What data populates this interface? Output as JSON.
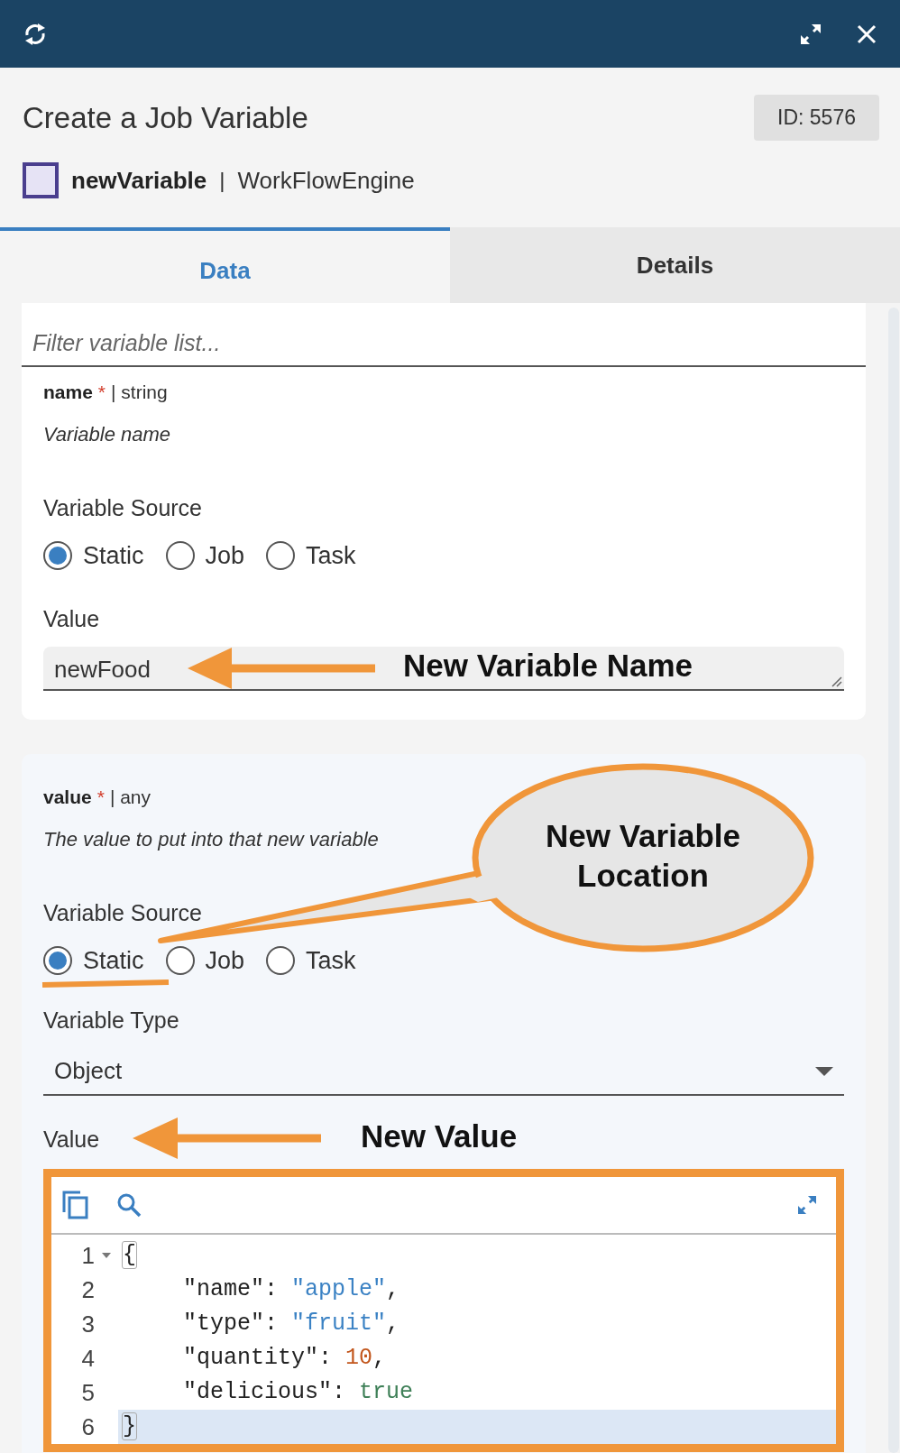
{
  "header": {
    "title": "Create a Job Variable",
    "id_badge": "ID: 5576",
    "name": "newVariable",
    "separator": "|",
    "engine": "WorkFlowEngine"
  },
  "tabs": [
    {
      "label": "Data",
      "selected": true
    },
    {
      "label": "Details",
      "selected": false
    }
  ],
  "filter": {
    "placeholder": "Filter variable list..."
  },
  "variables": [
    {
      "kind": "text",
      "name": "name",
      "required": "*",
      "type": "| string",
      "description": "Variable name",
      "source_label": "Variable Source",
      "sources": [
        {
          "label": "Static",
          "selected": true
        },
        {
          "label": "Job",
          "selected": false
        },
        {
          "label": "Task",
          "selected": false
        }
      ],
      "value_label": "Value",
      "value": "newFood"
    },
    {
      "kind": "json",
      "name": "value",
      "required": "*",
      "type": "| any",
      "description": "The value to put into that new variable",
      "source_label": "Variable Source",
      "sources": [
        {
          "label": "Static",
          "selected": true
        },
        {
          "label": "Job",
          "selected": false
        },
        {
          "label": "Task",
          "selected": false
        }
      ],
      "type_label": "Variable Type",
      "type_value": "Object",
      "value_label": "Value",
      "lines": [
        {
          "number": "1",
          "foldable": true,
          "indented": false,
          "active": false,
          "tokens": [
            {
              "kind": "brace",
              "text": "{"
            }
          ]
        },
        {
          "number": "2",
          "foldable": false,
          "indented": true,
          "active": false,
          "tokens": [
            {
              "kind": "key",
              "text": "\"name\""
            },
            {
              "kind": "punct",
              "text": ": "
            },
            {
              "kind": "string",
              "text": "\"apple\""
            },
            {
              "kind": "punct",
              "text": ","
            }
          ]
        },
        {
          "number": "3",
          "foldable": false,
          "indented": true,
          "active": false,
          "tokens": [
            {
              "kind": "key",
              "text": "\"type\""
            },
            {
              "kind": "punct",
              "text": ": "
            },
            {
              "kind": "string",
              "text": "\"fruit\""
            },
            {
              "kind": "punct",
              "text": ","
            }
          ]
        },
        {
          "number": "4",
          "foldable": false,
          "indented": true,
          "active": false,
          "tokens": [
            {
              "kind": "key",
              "text": "\"quantity\""
            },
            {
              "kind": "punct",
              "text": ": "
            },
            {
              "kind": "number",
              "text": "10"
            },
            {
              "kind": "punct",
              "text": ","
            }
          ]
        },
        {
          "number": "5",
          "foldable": false,
          "indented": true,
          "active": false,
          "tokens": [
            {
              "kind": "key",
              "text": "\"delicious\""
            },
            {
              "kind": "punct",
              "text": ": "
            },
            {
              "kind": "bool",
              "text": "true"
            }
          ]
        },
        {
          "number": "6",
          "foldable": false,
          "indented": false,
          "active": true,
          "tokens": [
            {
              "kind": "brace",
              "text": "}"
            }
          ]
        }
      ]
    }
  ],
  "annotations": [
    {
      "kind": "arrow",
      "label": "New Variable Name"
    },
    {
      "kind": "callout",
      "label": "New Variable Location"
    },
    {
      "kind": "arrow",
      "label": "New Value"
    }
  ]
}
